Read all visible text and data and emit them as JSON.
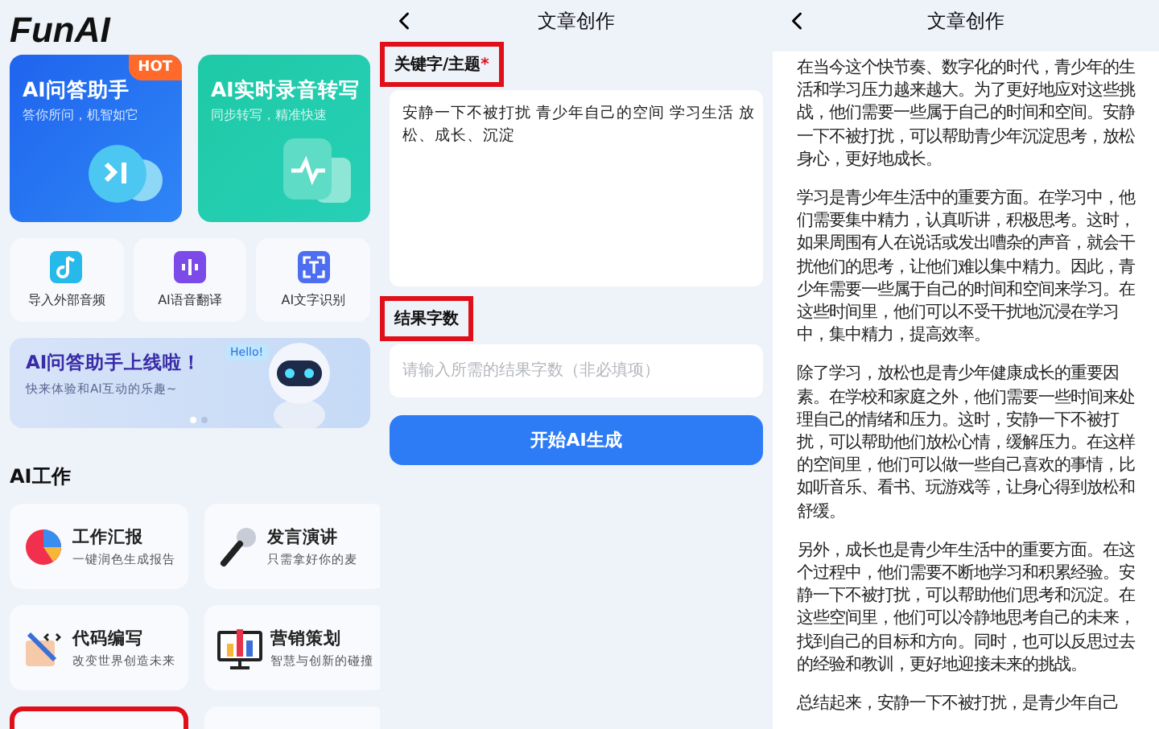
{
  "home": {
    "logo": "FunAI",
    "feature_cards": [
      {
        "kind": "chat",
        "title": "AI问答助手",
        "subtitle": "答你所问，机智如它",
        "badge": "HOT"
      },
      {
        "kind": "voice",
        "title": "AI实时录音转写",
        "subtitle": "同步转写，精准快速"
      }
    ],
    "tools": [
      {
        "kind": "audio",
        "label": "导入外部音频"
      },
      {
        "kind": "translate",
        "label": "AI语音翻译"
      },
      {
        "kind": "ocr",
        "label": "AI文字识别"
      }
    ],
    "banner": {
      "title": "AI问答助手上线啦！",
      "subtitle": "快来体验和AI互动的乐趣~",
      "bubble": "Hello!",
      "dots": [
        {
          "selected": true
        },
        {
          "selected": false
        }
      ]
    },
    "section_title": "AI工作",
    "work_cards": [
      {
        "kind": "report",
        "title": "工作汇报",
        "subtitle": "一键润色生成报告",
        "highlighted": false
      },
      {
        "kind": "speech",
        "title": "发言演讲",
        "subtitle": "只需拿好你的麦",
        "highlighted": false
      },
      {
        "kind": "code",
        "title": "代码编写",
        "subtitle": "改变世界创造未来",
        "highlighted": false
      },
      {
        "kind": "marketing",
        "title": "营销策划",
        "subtitle": "智慧与创新的碰撞",
        "highlighted": false
      },
      {
        "kind": "blank",
        "highlighted": true
      },
      {
        "kind": "blank",
        "highlighted": false
      }
    ]
  },
  "editor": {
    "title": "文章创作",
    "keyword_label": "关键字/主题",
    "required_mark": "*",
    "keyword_highlighted": true,
    "keyword_value": "安静一下不被打扰 青少年自己的空间 学习生活 放松、成长、沉淀",
    "count_label": "结果字数",
    "count_highlighted": true,
    "count_placeholder": "请输入所需的结果字数（非必填项）",
    "submit": "开始AI生成"
  },
  "result": {
    "title": "文章创作",
    "paragraphs": [
      "在当今这个快节奏、数字化的时代，青少年的生活和学习压力越来越大。为了更好地应对这些挑战，他们需要一些属于自己的时间和空间。安静一下不被打扰，可以帮助青少年沉淀思考，放松身心，更好地成长。",
      "学习是青少年生活中的重要方面。在学习中，他们需要集中精力，认真听讲，积极思考。这时，如果周围有人在说话或发出嘈杂的声音，就会干扰他们的思考，让他们难以集中精力。因此，青少年需要一些属于自己的时间和空间来学习。在这些时间里，他们可以不受干扰地沉浸在学习中，集中精力，提高效率。",
      "除了学习，放松也是青少年健康成长的重要因素。在学校和家庭之外，他们需要一些时间来处理自己的情绪和压力。这时，安静一下不被打扰，可以帮助他们放松心情，缓解压力。在这样的空间里，他们可以做一些自己喜欢的事情，比如听音乐、看书、玩游戏等，让身心得到放松和舒缓。",
      "另外，成长也是青少年生活中的重要方面。在这个过程中，他们需要不断地学习和积累经验。安静一下不被打扰，可以帮助他们思考和沉淀。在这些空间里，他们可以冷静地思考自己的未来，找到自己的目标和方向。同时，也可以反思过去的经验和教训，更好地迎接未来的挑战。",
      "总结起来，安静一下不被打扰，是青少年自己"
    ]
  }
}
